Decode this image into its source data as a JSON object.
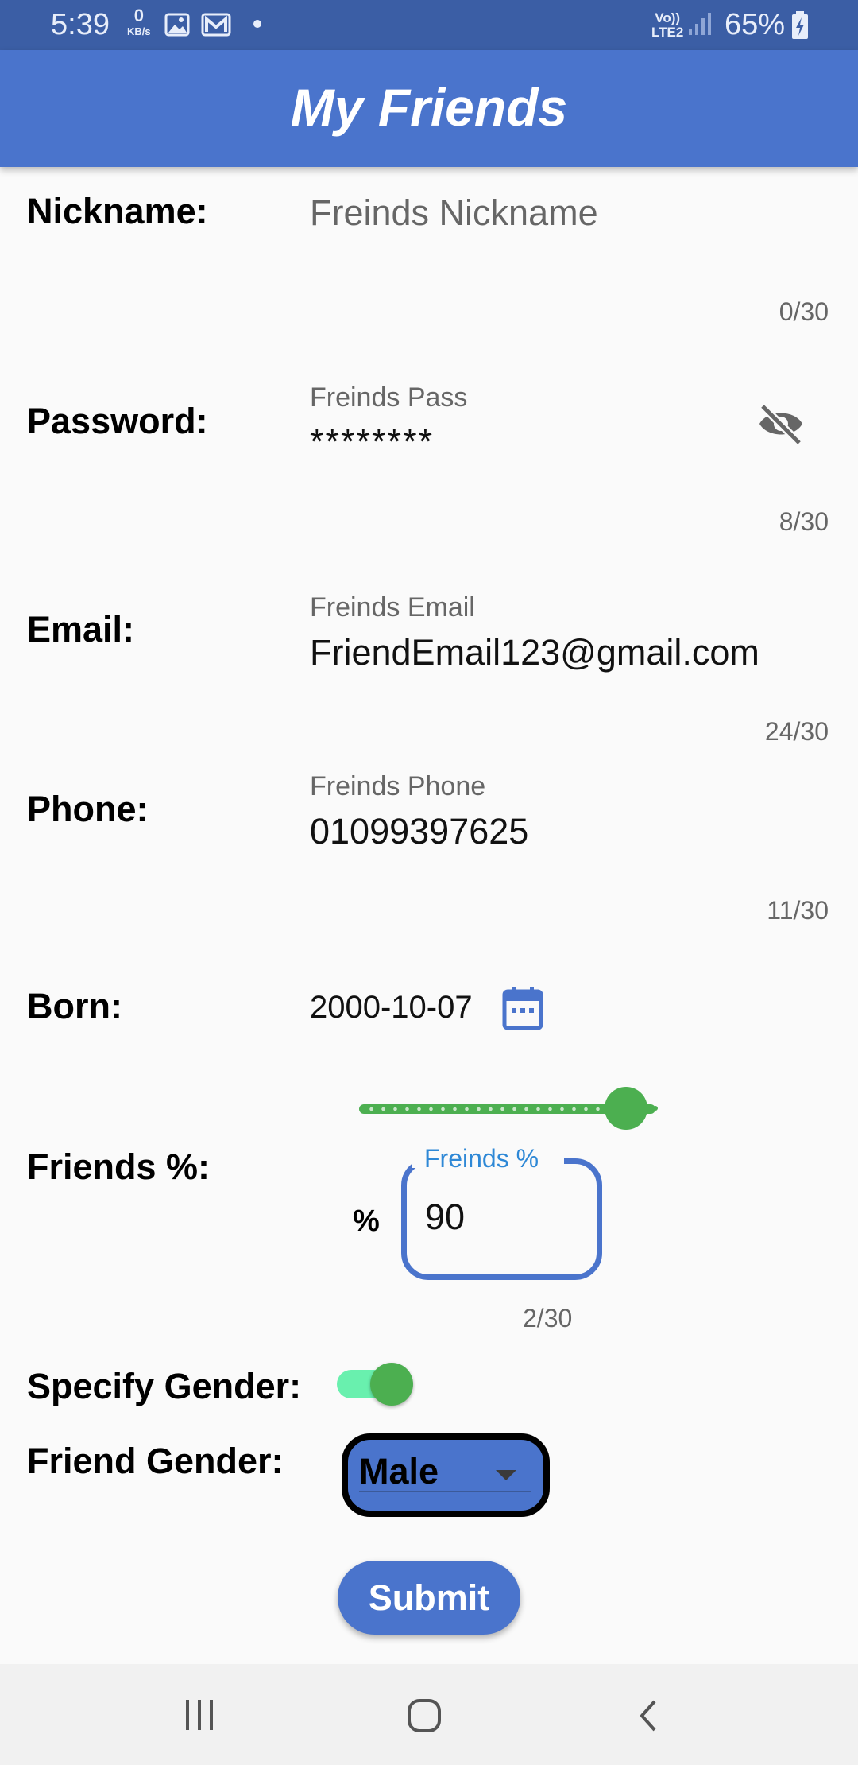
{
  "status_bar": {
    "time": "5:39",
    "data_speed_value": "0",
    "data_speed_unit": "KB/s",
    "network_top": "Vo))",
    "network_bottom": "LTE2",
    "battery": "65%"
  },
  "app_bar": {
    "title": "My Friends"
  },
  "form": {
    "nickname": {
      "label": "Nickname:",
      "hint": "Freinds Nickname",
      "counter": "0/30"
    },
    "password": {
      "label": "Password:",
      "floating_label": "Freinds Pass",
      "value": "********",
      "counter": "8/30"
    },
    "email": {
      "label": "Email:",
      "floating_label": "Freinds Email",
      "value": "FriendEmail123@gmail.com",
      "counter": "24/30"
    },
    "phone": {
      "label": "Phone:",
      "floating_label": "Freinds Phone",
      "value": "01099397625",
      "counter": "11/30"
    },
    "born": {
      "label": "Born:",
      "value": "2000-10-07"
    },
    "friends_percent": {
      "label": "Friends %:",
      "slider_value_percent": 90,
      "prefix": "%",
      "floating_label": "Freinds %",
      "value": "90",
      "counter": "2/30"
    },
    "specify_gender": {
      "label": "Specify Gender:",
      "enabled": true
    },
    "friend_gender": {
      "label": "Friend Gender:",
      "selected": "Male"
    },
    "submit_label": "Submit"
  },
  "colors": {
    "primary": "#4a74cc",
    "status_bar": "#3b5ea5",
    "accent_green": "#4caf50",
    "toggle_track": "#69f0ae",
    "floating_label_focused": "#2e88d6"
  },
  "icons": {
    "password_visibility": "eye-off-icon",
    "born_picker": "calendar-icon",
    "dropdown": "dropdown-arrow-icon",
    "nav": [
      "recent-apps-icon",
      "home-icon",
      "back-icon"
    ]
  }
}
